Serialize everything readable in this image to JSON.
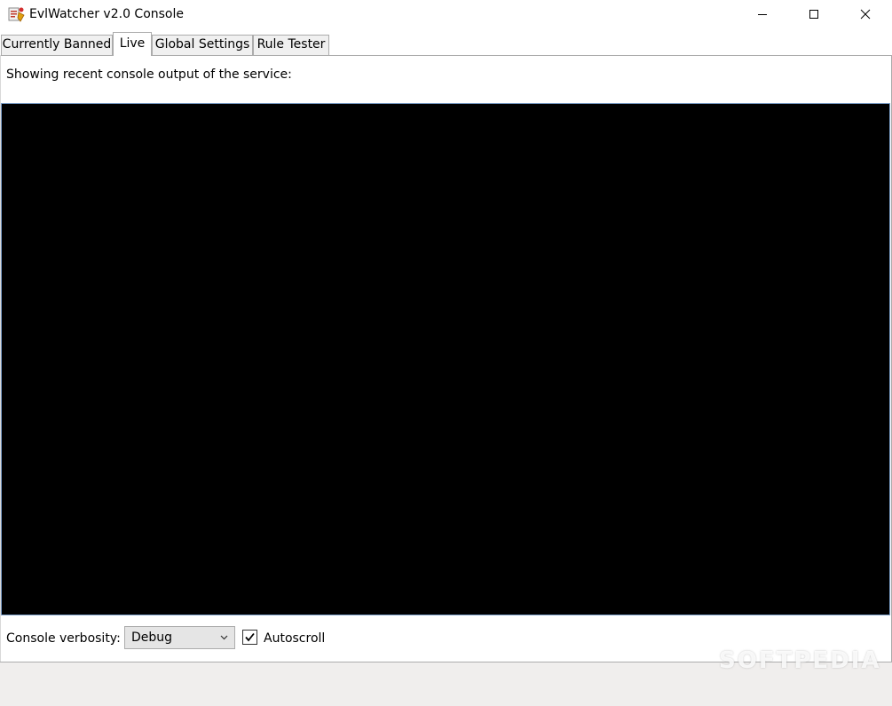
{
  "window": {
    "title": "EvlWatcher v2.0 Console",
    "icon": "app-icon",
    "controls": [
      "minimize-icon",
      "maximize-icon",
      "close-icon"
    ]
  },
  "tabs": [
    {
      "label": "Currently Banned",
      "active": false
    },
    {
      "label": "Live",
      "active": true
    },
    {
      "label": "Global Settings",
      "active": false
    },
    {
      "label": "Rule Tester",
      "active": false
    }
  ],
  "live": {
    "caption": "Showing recent console output of the service:",
    "console_output": "",
    "console_background": "#000000",
    "verbosity_label": "Console verbosity:",
    "verbosity_value": "Debug",
    "autoscroll_label": "Autoscroll",
    "autoscroll_checked": true
  },
  "watermark": "SOFTPEDIA"
}
